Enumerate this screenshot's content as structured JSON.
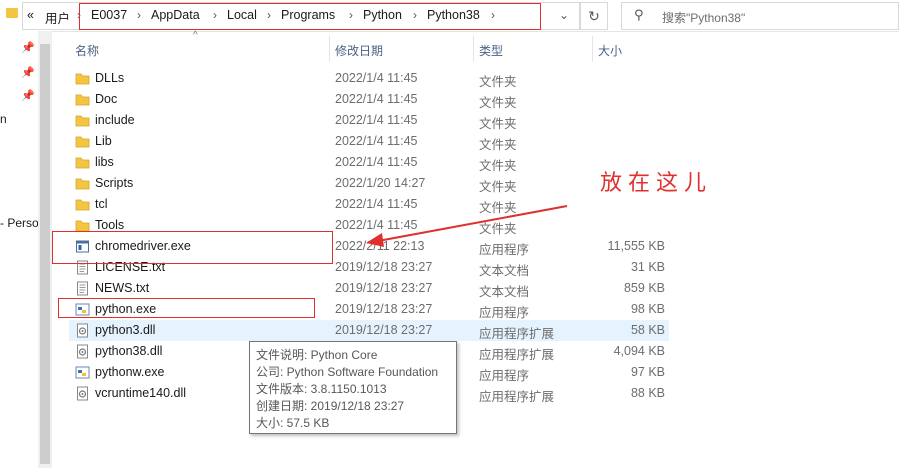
{
  "breadcrumb": {
    "overflow": "«",
    "items": [
      "用户",
      "E0037",
      "AppData",
      "Local",
      "Programs",
      "Python",
      "Python38"
    ]
  },
  "search": {
    "placeholder": "搜索\"Python38\""
  },
  "left_pane": {
    "fragments": [
      "n",
      "- Perso"
    ]
  },
  "columns": {
    "name": "名称",
    "date": "修改日期",
    "type": "类型",
    "size": "大小"
  },
  "files": [
    {
      "name": "DLLs",
      "date": "2022/1/4 11:45",
      "type": "文件夹",
      "size": "",
      "icon": "folder-icon"
    },
    {
      "name": "Doc",
      "date": "2022/1/4 11:45",
      "type": "文件夹",
      "size": "",
      "icon": "folder-icon"
    },
    {
      "name": "include",
      "date": "2022/1/4 11:45",
      "type": "文件夹",
      "size": "",
      "icon": "folder-icon"
    },
    {
      "name": "Lib",
      "date": "2022/1/4 11:45",
      "type": "文件夹",
      "size": "",
      "icon": "folder-icon"
    },
    {
      "name": "libs",
      "date": "2022/1/4 11:45",
      "type": "文件夹",
      "size": "",
      "icon": "folder-icon"
    },
    {
      "name": "Scripts",
      "date": "2022/1/20 14:27",
      "type": "文件夹",
      "size": "",
      "icon": "folder-icon"
    },
    {
      "name": "tcl",
      "date": "2022/1/4 11:45",
      "type": "文件夹",
      "size": "",
      "icon": "folder-icon"
    },
    {
      "name": "Tools",
      "date": "2022/1/4 11:45",
      "type": "文件夹",
      "size": "",
      "icon": "folder-icon"
    },
    {
      "name": "chromedriver.exe",
      "date": "2022/2/11 22:13",
      "type": "应用程序",
      "size": "11,555 KB",
      "icon": "exe-icon"
    },
    {
      "name": "LICENSE.txt",
      "date": "2019/12/18 23:27",
      "type": "文本文档",
      "size": "31 KB",
      "icon": "text-file-icon"
    },
    {
      "name": "NEWS.txt",
      "date": "2019/12/18 23:27",
      "type": "文本文档",
      "size": "859 KB",
      "icon": "text-file-icon"
    },
    {
      "name": "python.exe",
      "date": "2019/12/18 23:27",
      "type": "应用程序",
      "size": "98 KB",
      "icon": "python-icon"
    },
    {
      "name": "python3.dll",
      "date": "2019/12/18 23:27",
      "type": "应用程序扩展",
      "size": "58 KB",
      "icon": "dll-icon"
    },
    {
      "name": "python38.dll",
      "date": "",
      "type": "应用程序扩展",
      "size": "4,094 KB",
      "icon": "dll-icon"
    },
    {
      "name": "pythonw.exe",
      "date": "",
      "type": "应用程序",
      "size": "97 KB",
      "icon": "python-icon"
    },
    {
      "name": "vcruntime140.dll",
      "date": "",
      "type": "应用程序扩展",
      "size": "88 KB",
      "icon": "dll-icon"
    }
  ],
  "tooltip": {
    "lines": [
      "文件说明: Python Core",
      "公司: Python Software Foundation",
      "文件版本: 3.8.1150.1013",
      "创建日期: 2019/12/18 23:27",
      "大小: 57.5 KB"
    ]
  },
  "annotation": {
    "text": "放在这儿",
    "color": "#e0302e"
  },
  "colors": {
    "accent": "#e0302e",
    "header_text": "#4d6185",
    "hover_row": "#e5f3ff",
    "folder": "#f4c542"
  }
}
